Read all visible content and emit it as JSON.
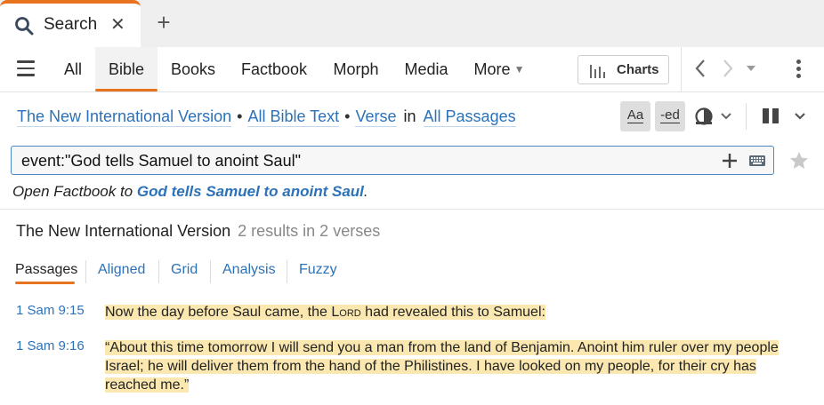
{
  "tabs": {
    "doc_tab_label": "Search",
    "close_glyph": "✕",
    "new_tab_glyph": "+"
  },
  "toolbar": {
    "nav_items": [
      "All",
      "Bible",
      "Books",
      "Factbook",
      "Morph",
      "Media",
      "More"
    ],
    "active_item": "Bible",
    "charts_label": "Charts"
  },
  "scope": {
    "version": "The New International Version",
    "bullet": "•",
    "range": "All Bible Text",
    "unit": "Verse",
    "in_word": "in",
    "passages": "All Passages"
  },
  "format_buttons": {
    "aa_label": "Aa",
    "ed_label": "-ed"
  },
  "search": {
    "query": "event:\"God tells Samuel to anoint Saul\""
  },
  "factbook_hint": {
    "prefix": "Open Factbook to ",
    "link": "God tells Samuel to anoint Saul",
    "suffix": "."
  },
  "results": {
    "version": "The New International Version",
    "summary": "2 results in 2 verses",
    "view_tabs": [
      "Passages",
      "Aligned",
      "Grid",
      "Analysis",
      "Fuzzy"
    ],
    "active_view": "Passages",
    "items": [
      {
        "ref": "1 Sam 9:15",
        "text_before": "Now the day before Saul came, the ",
        "text_smallcaps": "Lord",
        "text_after": " had revealed this to Samuel:"
      },
      {
        "ref": "1 Sam 9:16",
        "text_line1": "“About this time tomorrow I will send you a man from the land of Benjamin. Anoint him ruler over my people",
        "text_line2": "Israel; he will deliver them from the hand of the Philistines. I have looked on my people, for their cry has",
        "text_line3": "reached me.”"
      }
    ]
  },
  "colors": {
    "accent": "#e8731f",
    "link": "#2d72b8",
    "highlight": "#fbe8b0"
  }
}
